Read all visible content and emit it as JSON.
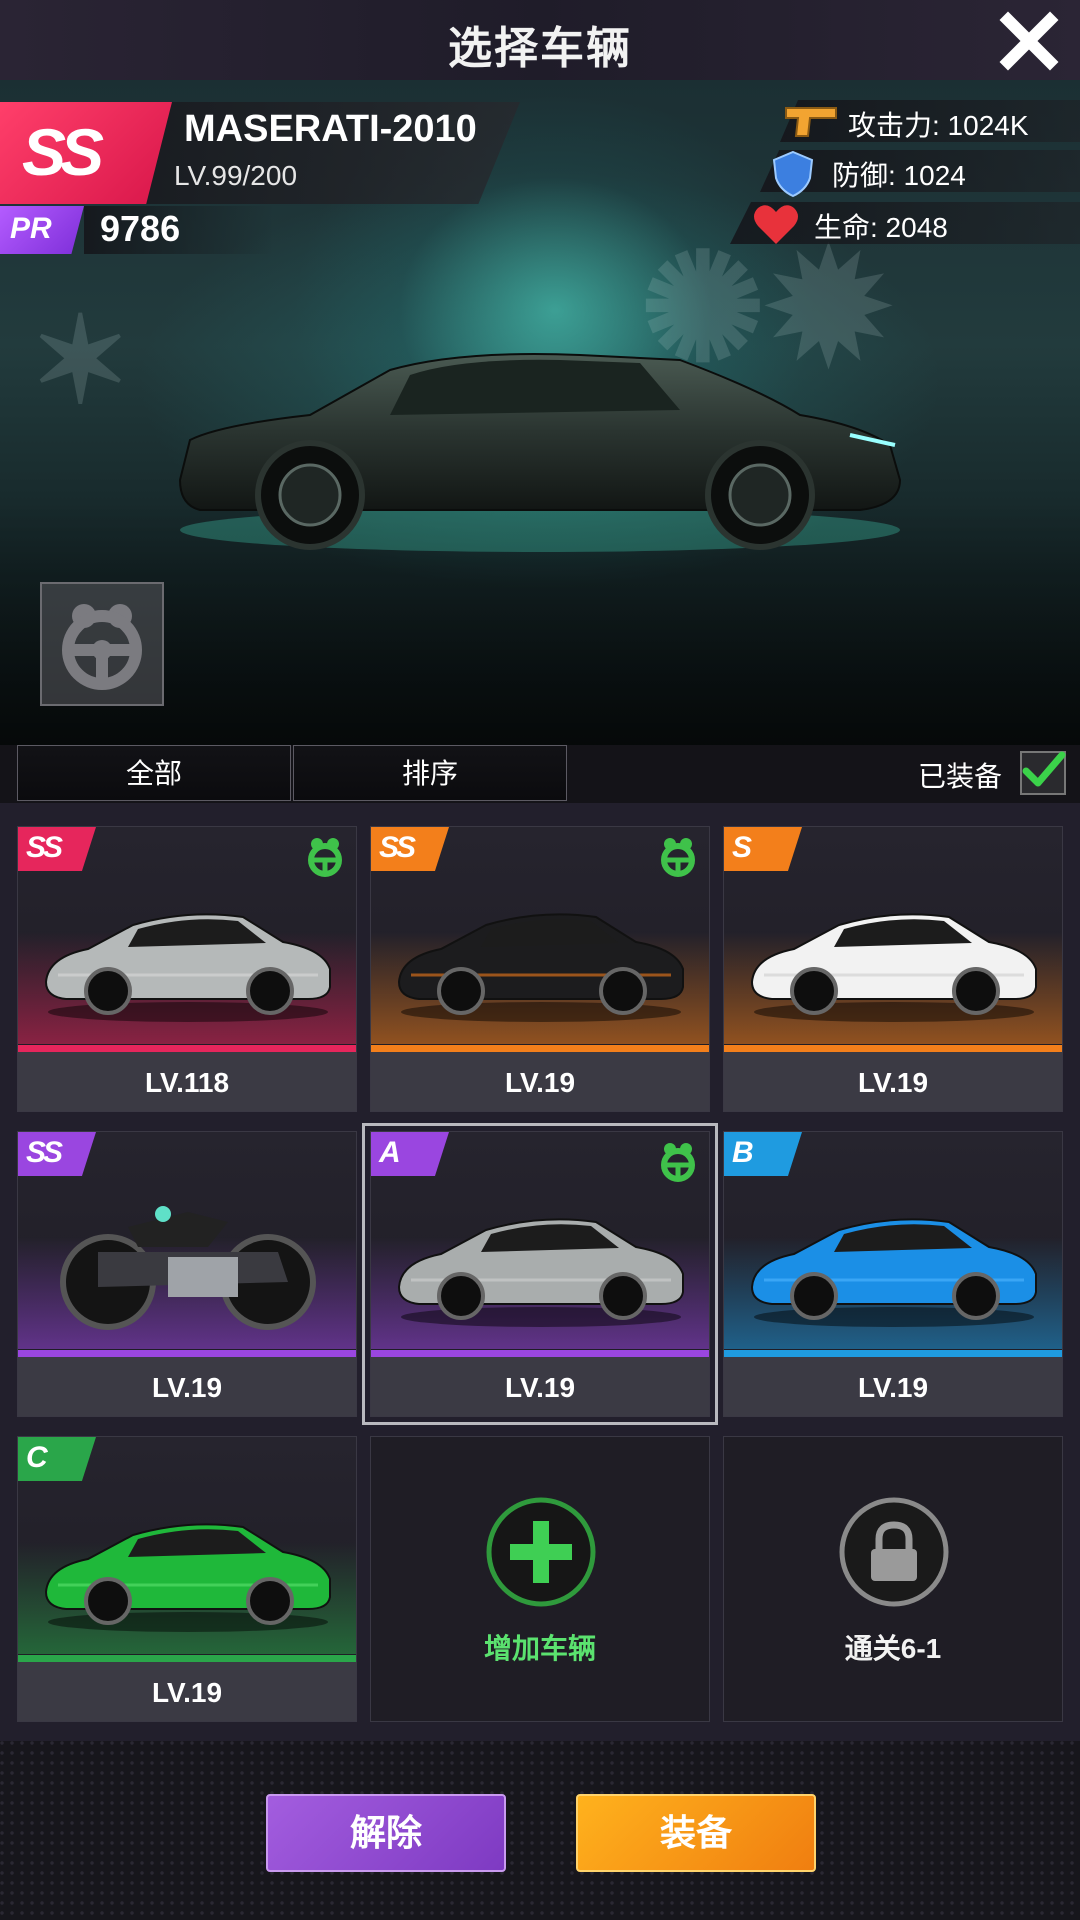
{
  "header": {
    "title": "选择车辆"
  },
  "hero": {
    "rank": "SS",
    "car_name": "MASERATI-2010",
    "level": "LV.99/200",
    "pr_label": "PR",
    "pr_value": "9786",
    "stats": [
      {
        "icon": "pistol-icon",
        "label": "攻击力: 1024K",
        "color": "#f2a431"
      },
      {
        "icon": "shield-icon",
        "label": "防御: 1024",
        "color": "#3c7fe0"
      },
      {
        "icon": "heart-icon",
        "label": "生命: 2048",
        "color": "#e8323b"
      }
    ]
  },
  "filters": {
    "all_label": "全部",
    "sort_label": "排序",
    "equipped_label": "已装备",
    "equipped_checked": true
  },
  "cars": [
    {
      "tier": "SS",
      "tier_color": "#e6265c",
      "level": "LV.118",
      "has_driver": true,
      "body_color": "#b5b9b9",
      "accent": "#d9d9d9"
    },
    {
      "tier": "SS",
      "tier_color": "#f37f1b",
      "level": "LV.19",
      "has_driver": true,
      "body_color": "#1c1c1e",
      "accent": "#f07a1a"
    },
    {
      "tier": "S",
      "tier_color": "#f37f1b",
      "level": "LV.19",
      "has_driver": false,
      "body_color": "#f2f2f2",
      "accent": "#cfcfcf"
    },
    {
      "tier": "SS",
      "tier_color": "#9a46e0",
      "level": "LV.19",
      "has_driver": false,
      "body_color": "#3a3a40",
      "accent": "#9fa3a8"
    },
    {
      "tier": "A",
      "tier_color": "#9a46e0",
      "level": "LV.19",
      "has_driver": true,
      "body_color": "#a9adad",
      "accent": "#d0d0d0",
      "selected": true
    },
    {
      "tier": "B",
      "tier_color": "#1f9be0",
      "level": "LV.19",
      "has_driver": false,
      "body_color": "#1b8fe6",
      "accent": "#4fb6ff"
    },
    {
      "tier": "C",
      "tier_color": "#2aa64a",
      "level": "LV.19",
      "has_driver": false,
      "body_color": "#1fb83a",
      "accent": "#5be26f"
    }
  ],
  "add_slot": {
    "label": "增加车辆",
    "icon": "plus-icon"
  },
  "locked_slot": {
    "label": "通关6-1",
    "icon": "lock-icon"
  },
  "actions": {
    "release_label": "解除",
    "equip_label": "装备"
  }
}
